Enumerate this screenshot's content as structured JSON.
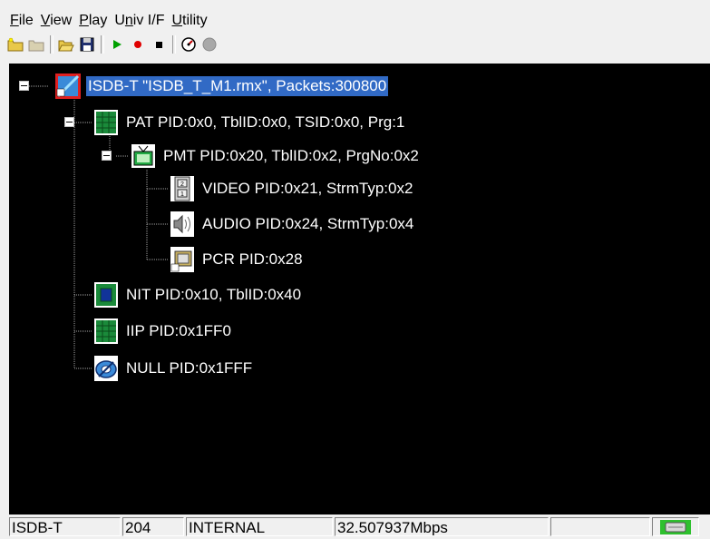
{
  "menu": [
    {
      "pre": "",
      "accel": "F",
      "post": "ile"
    },
    {
      "pre": "",
      "accel": "V",
      "post": "iew"
    },
    {
      "pre": "",
      "accel": "P",
      "post": "lay"
    },
    {
      "pre": "U",
      "accel": "n",
      "post": "iv I/F"
    },
    {
      "pre": "",
      "accel": "U",
      "post": "tility"
    }
  ],
  "toolbar": {
    "icons": [
      "new-folder-icon",
      "folder-icon",
      "open-icon",
      "save-icon",
      "play-icon",
      "record-icon",
      "stop-icon",
      "speedometer-icon",
      "disc-icon"
    ],
    "colors": {
      "play": "#00a000",
      "record": "#e00000",
      "stop": "#000000"
    }
  },
  "tree": {
    "root": "ISDB-T \"ISDB_T_M1.rmx\", Packets:300800",
    "pat": "PAT PID:0x0, TblID:0x0, TSID:0x0, Prg:1",
    "pmt": "PMT PID:0x20, TblID:0x2, PrgNo:0x2",
    "video": "VIDEO PID:0x21, StrmTyp:0x2",
    "audio": "AUDIO PID:0x24, StrmTyp:0x4",
    "pcr": "PCR PID:0x28",
    "nit": "NIT PID:0x10, TblID:0x40",
    "iip": "IIP PID:0x1FF0",
    "null": "NULL PID:0x1FFF"
  },
  "status": {
    "mode": "ISDB-T",
    "packet_size": "204",
    "clock": "INTERNAL",
    "rate": "32.507937Mbps",
    "empty": ""
  },
  "colors": {
    "tree_bg": "#000000",
    "selection": "#316ac5",
    "text": "#ffffff"
  }
}
